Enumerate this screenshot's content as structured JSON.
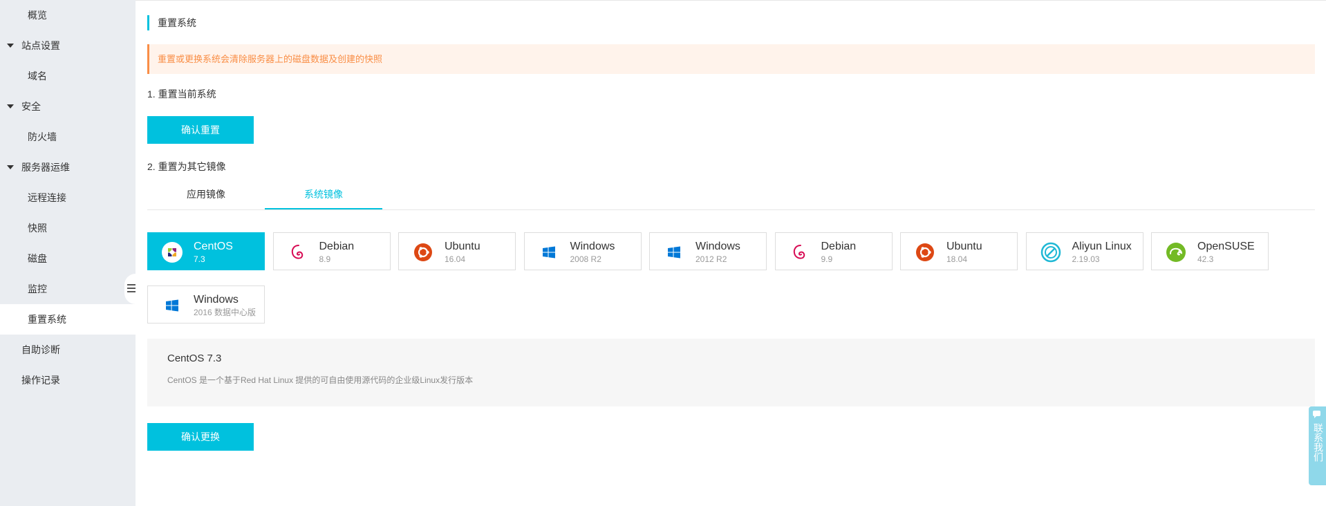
{
  "sidebar": {
    "items": [
      {
        "label": "概览",
        "level": 2,
        "caret": false,
        "active": false
      },
      {
        "label": "站点设置",
        "level": 1,
        "caret": true,
        "active": false
      },
      {
        "label": "域名",
        "level": 2,
        "caret": false,
        "active": false
      },
      {
        "label": "安全",
        "level": 1,
        "caret": true,
        "active": false
      },
      {
        "label": "防火墙",
        "level": 2,
        "caret": false,
        "active": false
      },
      {
        "label": "服务器运维",
        "level": 1,
        "caret": true,
        "active": false
      },
      {
        "label": "远程连接",
        "level": 2,
        "caret": false,
        "active": false
      },
      {
        "label": "快照",
        "level": 2,
        "caret": false,
        "active": false
      },
      {
        "label": "磁盘",
        "level": 2,
        "caret": false,
        "active": false
      },
      {
        "label": "监控",
        "level": 2,
        "caret": false,
        "active": false
      },
      {
        "label": "重置系统",
        "level": 2,
        "caret": false,
        "active": true
      },
      {
        "label": "自助诊断",
        "level": 1,
        "caret": false,
        "active": false
      },
      {
        "label": "操作记录",
        "level": 1,
        "caret": false,
        "active": false
      }
    ]
  },
  "page": {
    "title": "重置系统",
    "warning": "重置或更换系统会清除服务器上的磁盘数据及创建的快照",
    "step1": "1. 重置当前系统",
    "reset_button": "确认重置",
    "step2": "2. 重置为其它镜像",
    "tabs": [
      {
        "label": "应用镜像",
        "active": false
      },
      {
        "label": "系统镜像",
        "active": true
      }
    ],
    "confirm_change_button": "确认更换"
  },
  "os_images": [
    {
      "name": "CentOS",
      "version": "7.3",
      "icon": "centos-icon",
      "selected": true
    },
    {
      "name": "Debian",
      "version": "8.9",
      "icon": "debian-icon",
      "selected": false
    },
    {
      "name": "Ubuntu",
      "version": "16.04",
      "icon": "ubuntu-icon",
      "selected": false
    },
    {
      "name": "Windows",
      "version": "2008 R2",
      "icon": "windows-icon",
      "selected": false
    },
    {
      "name": "Windows",
      "version": "2012 R2",
      "icon": "windows-icon",
      "selected": false
    },
    {
      "name": "Debian",
      "version": "9.9",
      "icon": "debian-icon",
      "selected": false
    },
    {
      "name": "Ubuntu",
      "version": "18.04",
      "icon": "ubuntu-icon",
      "selected": false
    },
    {
      "name": "Aliyun Linux",
      "version": "2.19.03",
      "icon": "aliyun-icon",
      "selected": false
    },
    {
      "name": "OpenSUSE",
      "version": "42.3",
      "icon": "opensuse-icon",
      "selected": false
    },
    {
      "name": "Windows",
      "version": "2016 数据中心版",
      "icon": "windows-icon",
      "selected": false
    }
  ],
  "description": {
    "title": "CentOS 7.3",
    "text": "CentOS 是一个基于Red Hat Linux 提供的可自由使用源代码的企业级Linux发行版本"
  },
  "contact": {
    "label": "联系我们"
  },
  "colors": {
    "accent": "#00c1de",
    "warning": "#f98e46",
    "warning_bg": "#fff3eb",
    "sidebar_bg": "#eaedf1",
    "debian": "#d70a53",
    "ubuntu": "#dd4814",
    "windows": "#0078d7",
    "aliyun": "#1fb8d5",
    "opensuse": "#73ba25"
  }
}
